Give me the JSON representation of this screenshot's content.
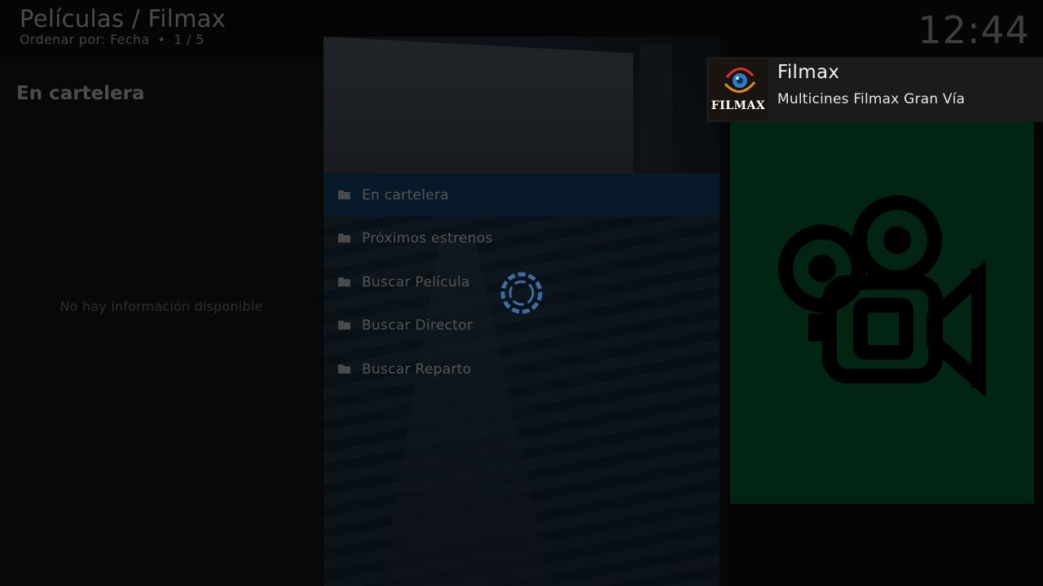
{
  "header": {
    "breadcrumb": "Películas / Filmax",
    "sort_label": "Ordenar por: Fecha",
    "separator": "•",
    "position": "1 / 5",
    "clock": "12:44"
  },
  "info_panel": {
    "selected_title": "En cartelera",
    "empty_message": "No hay información disponible"
  },
  "menu": {
    "items": [
      {
        "label": "En cartelera",
        "icon": "folder-icon",
        "focused": true
      },
      {
        "label": "Próximos estrenos",
        "icon": "folder-icon"
      },
      {
        "label": "Buscar Película",
        "icon": "folder-icon"
      },
      {
        "label": "Buscar Director",
        "icon": "folder-icon"
      },
      {
        "label": "Buscar Reparto",
        "icon": "folder-icon"
      }
    ]
  },
  "poster": {
    "icon": "movie-camera-icon",
    "background_color": "#012512"
  },
  "notification": {
    "title": "Filmax",
    "message": "Multicines Filmax Gran Vía",
    "logo_text": "FILMAX"
  },
  "colors": {
    "focus_highlight": "#081a2a",
    "spinner": "#3a6ea5"
  }
}
